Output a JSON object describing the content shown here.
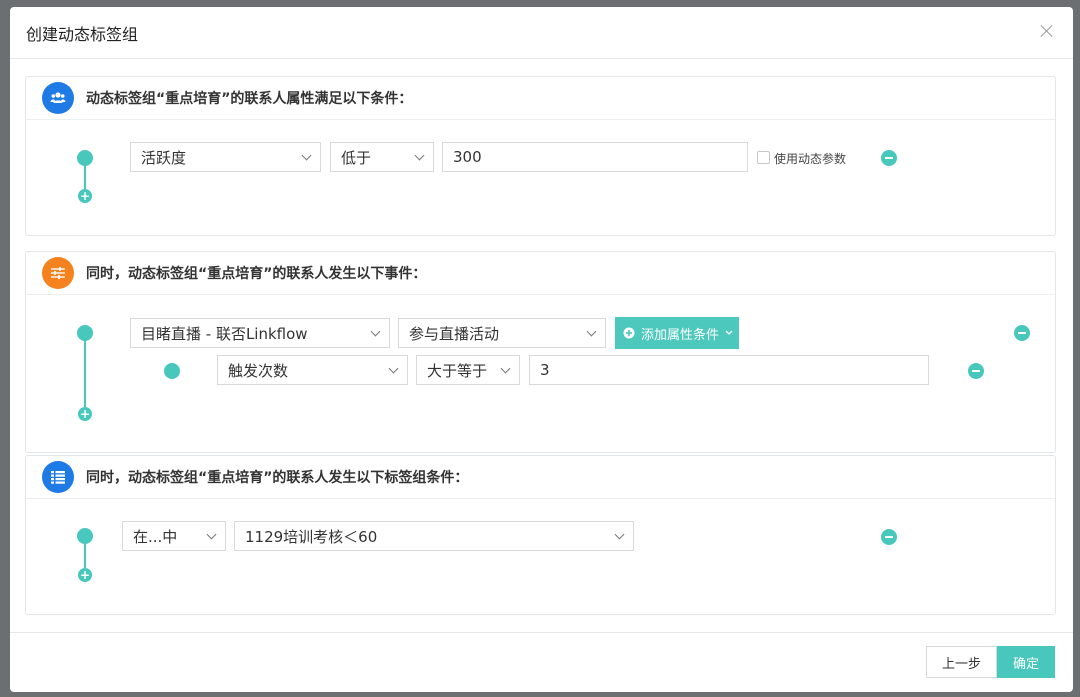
{
  "modal": {
    "title": "创建动态标签组"
  },
  "section1": {
    "title": "动态标签组“重点培育”的联系人属性满足以下条件：",
    "icon": "users-icon",
    "icon_color": "#1e7be6",
    "attribute_select": "活跃度",
    "operator_select": "低于",
    "value_input": "300",
    "dynamic_param_label": "使用动态参数"
  },
  "section2": {
    "title": "同时，动态标签组“重点培育”的联系人发生以下事件：",
    "icon": "sliders-icon",
    "icon_color": "#f5811f",
    "event_select": "目睹直播 - 联否Linkflow",
    "activity_select": "参与直播活动",
    "add_attr_label": "添加属性条件",
    "sub_attribute_select": "触发次数",
    "sub_operator_select": "大于等于",
    "sub_value_input": "3"
  },
  "section3": {
    "title": "同时，动态标签组“重点培育”的联系人发生以下标签组条件：",
    "icon": "list-icon",
    "icon_color": "#1e7be6",
    "in_select": "在...中",
    "tag_group_select": "1129培训考核＜60"
  },
  "footer": {
    "prev_label": "上一步",
    "confirm_label": "确定"
  },
  "colors": {
    "accent": "#48c8bd"
  }
}
